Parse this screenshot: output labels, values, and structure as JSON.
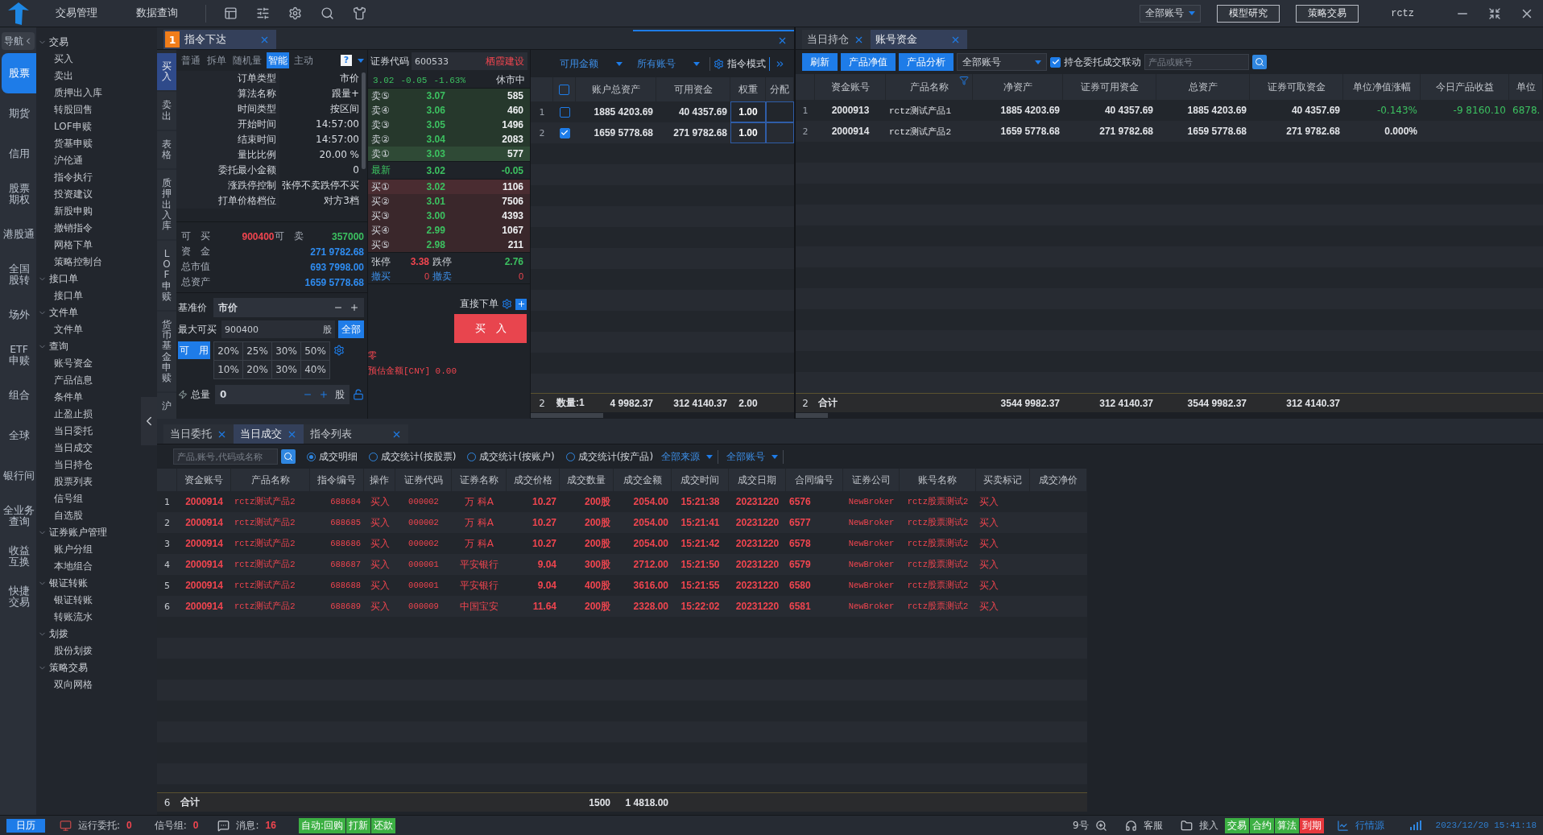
{
  "top_bar": {
    "menus": [
      "交易管理",
      "数据查询"
    ],
    "account_select": "全部账号",
    "buttons": [
      "模型研究",
      "策略交易"
    ],
    "user": "rctz"
  },
  "rail": {
    "toggle": "导航",
    "items": [
      {
        "lines": [
          "股票"
        ],
        "selected": true
      },
      {
        "lines": [
          "期货"
        ],
        "selected": false
      },
      {
        "lines": [
          "信用"
        ],
        "selected": false
      },
      {
        "lines": [
          "股票",
          "期权"
        ],
        "selected": false
      },
      {
        "lines": [
          "港股通"
        ],
        "selected": false
      },
      {
        "lines": [
          "全国",
          "股转"
        ],
        "selected": false
      },
      {
        "lines": [
          "场外"
        ],
        "selected": false
      },
      {
        "lines": [
          "ETF",
          "申赎"
        ],
        "selected": false
      },
      {
        "lines": [
          "组合"
        ],
        "selected": false
      },
      {
        "lines": [
          "全球"
        ],
        "selected": false
      },
      {
        "lines": [
          "银行间"
        ],
        "selected": false
      },
      {
        "lines": [
          "全业务",
          "查询"
        ],
        "selected": false
      },
      {
        "lines": [
          "收益",
          "互换"
        ],
        "selected": false
      },
      {
        "lines": [
          "快捷",
          "交易"
        ],
        "selected": false
      }
    ]
  },
  "nav_tree": [
    {
      "label": "交易",
      "expanded": true,
      "children": [
        {
          "label": "买入"
        },
        {
          "label": "卖出"
        },
        {
          "label": "质押出入库"
        },
        {
          "label": "转股回售"
        },
        {
          "label": "LOF申赎"
        },
        {
          "label": "货基申赎"
        },
        {
          "label": "沪伦通"
        },
        {
          "label": "指令执行"
        },
        {
          "label": "投资建议"
        },
        {
          "label": "新股申购"
        },
        {
          "label": "撤销指令"
        },
        {
          "label": "网格下单"
        },
        {
          "label": "策略控制台"
        }
      ]
    },
    {
      "label": "接口单",
      "expanded": true,
      "children": [
        {
          "label": "接口单"
        }
      ]
    },
    {
      "label": "文件单",
      "expanded": true,
      "children": [
        {
          "label": "文件单"
        }
      ]
    },
    {
      "label": "查询",
      "expanded": true,
      "children": [
        {
          "label": "账号资金"
        },
        {
          "label": "产品信息"
        },
        {
          "label": "条件单"
        },
        {
          "label": "止盈止损"
        },
        {
          "label": "当日委托"
        },
        {
          "label": "当日成交"
        },
        {
          "label": "当日持仓"
        },
        {
          "label": "股票列表"
        },
        {
          "label": "信号组"
        },
        {
          "label": "自选股"
        }
      ]
    },
    {
      "label": "证券账户管理",
      "expanded": true,
      "children": [
        {
          "label": "账户分组"
        },
        {
          "label": "本地组合"
        }
      ]
    },
    {
      "label": "银证转账",
      "expanded": true,
      "children": [
        {
          "label": "银证转账"
        },
        {
          "label": "转账流水"
        }
      ]
    },
    {
      "label": "划拨",
      "expanded": true,
      "children": [
        {
          "label": "股份划拨"
        }
      ]
    },
    {
      "label": "策略交易",
      "expanded": true,
      "children": [
        {
          "label": "双向网格"
        }
      ]
    }
  ],
  "order_panel": {
    "tab": {
      "number": "1",
      "label": "指令下达",
      "selected": true
    },
    "side_tabs": [
      {
        "label": "买入",
        "selected": true
      },
      {
        "label": "卖出",
        "selected": false
      },
      {
        "label": "表格",
        "selected": false
      },
      {
        "label": "质押出入库",
        "selected": false
      },
      {
        "label": "LOF申赎",
        "selected": false
      },
      {
        "label": "货币基金申赎",
        "selected": false
      },
      {
        "label": "沪",
        "selected": false
      }
    ],
    "mode_tabs": [
      {
        "label": "普通",
        "selected": false
      },
      {
        "label": "拆单",
        "selected": false
      },
      {
        "label": "随机量",
        "selected": false
      },
      {
        "label": "智能",
        "selected": true
      },
      {
        "label": "主动",
        "selected": false
      }
    ],
    "help": "?",
    "params": [
      {
        "label": "订单类型",
        "value": "市价"
      },
      {
        "label": "算法名称",
        "value": "跟量+"
      },
      {
        "label": "时间类型",
        "value": "按区间"
      },
      {
        "label": "开始时间",
        "value": "14:57:00"
      },
      {
        "label": "结束时间",
        "value": "14:57:00"
      },
      {
        "label": "量比比例",
        "value": "20.00 %"
      },
      {
        "label": "委托最小金额",
        "value": "0"
      },
      {
        "label": "涨跌停控制",
        "value": "张停不卖跌停不买"
      },
      {
        "label": "打单价格档位",
        "value": "对方3档"
      }
    ],
    "summary": {
      "can_buy": {
        "label": "可　买",
        "value": "900400"
      },
      "can_sell": {
        "label": "可　卖",
        "value": "357000"
      },
      "rows": [
        {
          "label": "资　金",
          "value": "271 9782.68"
        },
        {
          "label": "总市值",
          "value": "693 7998.00"
        },
        {
          "label": "总资产",
          "value": "1659 5778.68"
        }
      ]
    },
    "base_price": {
      "label": "基准价",
      "value": "市价"
    },
    "max_buy": {
      "label": "最大可买",
      "value": "900400",
      "unit": "股",
      "button": "全部"
    },
    "available": "可　用",
    "percents": [
      "20%",
      "25%",
      "30%",
      "50%",
      "10%",
      "20%",
      "30%",
      "40%"
    ],
    "total": {
      "label": "总量",
      "value": "0",
      "unit": "股"
    },
    "direct_order": "直接下单",
    "buy_button": "买　入",
    "odd_lot": "零",
    "estimate": "预估金额[CNY] 0.00",
    "quote": {
      "code_label": "证券代码",
      "code": "600533",
      "name": "栖霞建设",
      "price": "3.02",
      "change": "-0.05",
      "change_pct": "-1.63%",
      "status": "休市中",
      "asks": [
        {
          "label": "卖⑤",
          "price": "3.07",
          "volume": "585"
        },
        {
          "label": "卖④",
          "price": "3.06",
          "volume": "460"
        },
        {
          "label": "卖③",
          "price": "3.05",
          "volume": "1496"
        },
        {
          "label": "卖②",
          "price": "3.04",
          "volume": "2083"
        },
        {
          "label": "卖①",
          "price": "3.03",
          "volume": "577"
        }
      ],
      "last": {
        "label": "最新",
        "price": "3.02",
        "change": "-0.05"
      },
      "bids": [
        {
          "label": "买①",
          "price": "3.02",
          "volume": "1106"
        },
        {
          "label": "买②",
          "price": "3.01",
          "volume": "7506"
        },
        {
          "label": "买③",
          "price": "3.00",
          "volume": "4393"
        },
        {
          "label": "买④",
          "price": "2.99",
          "volume": "1067"
        },
        {
          "label": "买⑤",
          "price": "2.98",
          "volume": "211"
        }
      ],
      "limit_up": {
        "label": "张停",
        "value": "3.38"
      },
      "limit_down": {
        "label": "跌停",
        "value": "2.76"
      },
      "cancel_buy": {
        "label": "撤买",
        "value": "0"
      },
      "cancel_sell": {
        "label": "撤卖",
        "value": "0"
      }
    },
    "accounts": {
      "filters": [
        "可用金额",
        "所有账号"
      ],
      "mode": "指令模式",
      "select_all_checked": false,
      "columns": [
        "账户总资产",
        "可用资金",
        "权重",
        "分配"
      ],
      "rows": [
        {
          "index": "1",
          "checked": false,
          "total": "1885 4203.69",
          "available": "40 4357.69",
          "weight": "1.00"
        },
        {
          "index": "2",
          "checked": true,
          "total": "1659 5778.68",
          "available": "271 9782.68",
          "weight": "1.00"
        }
      ],
      "footer": {
        "index": "2",
        "count": "数量:1",
        "total": "4 9982.37",
        "available": "312 4140.37",
        "weight": "2.00"
      }
    }
  },
  "account_panel": {
    "tabs": [
      {
        "label": "当日持仓",
        "selected": false
      },
      {
        "label": "账号资金",
        "selected": true
      }
    ],
    "buttons": [
      "刷新",
      "产品净值",
      "产品分析"
    ],
    "account_select": "全部账号",
    "link": {
      "label": "持仓委托成交联动",
      "checked": true
    },
    "search_placeholder": "产品或账号",
    "columns": [
      "资金账号",
      "产品名称",
      "净资产",
      "证券可用资金",
      "总资产",
      "证券可取资金",
      "单位净值涨幅",
      "今日产品收益",
      "单位"
    ],
    "rows": [
      {
        "index": "1",
        "cells": [
          "2000913",
          "rctz测试产品1",
          "1885 4203.69",
          "40 4357.69",
          "1885 4203.69",
          "40 4357.69",
          {
            "text": "-0.143%",
            "color": "#3cc060"
          },
          {
            "text": "-9 8160.10",
            "color": "#3cc060"
          },
          {
            "text": "6878.",
            "color": "#3cc060"
          }
        ]
      },
      {
        "index": "2",
        "cells": [
          "2000914",
          "rctz测试产品2",
          "1659 5778.68",
          "271 9782.68",
          "1659 5778.68",
          "271 9782.68",
          "0.000%"
        ]
      }
    ],
    "footer": {
      "index": "2",
      "label": "合计",
      "cells": [
        "3544 9982.37",
        "312 4140.37",
        "3544 9982.37",
        "312 4140.37"
      ]
    }
  },
  "trades_panel": {
    "tabs": [
      {
        "label": "当日委托",
        "selected": false
      },
      {
        "label": "当日成交",
        "selected": true
      },
      {
        "label": "指令列表",
        "selected": false
      }
    ],
    "search_placeholder": "产品,账号,代码或名称",
    "views": [
      {
        "label": "成交明细",
        "selected": true
      },
      {
        "label": "成交统计(按股票)",
        "selected": false
      },
      {
        "label": "成交统计(按账户)",
        "selected": false
      },
      {
        "label": "成交统计(按产品)",
        "selected": false
      }
    ],
    "filters": [
      "全部来源",
      "全部账号"
    ],
    "columns": [
      "资金账号",
      "产品名称",
      "指令编号",
      "操作",
      "证券代码",
      "证券名称",
      "成交价格",
      "成交数量",
      "成交金额",
      "成交时间",
      "成交日期",
      "合同编号",
      "证券公司",
      "账号名称",
      "买卖标记",
      "成交净价"
    ],
    "rows": [
      {
        "index": "1",
        "cells": [
          "2000914",
          "rctz测试产品2",
          "688684",
          "买入",
          "000002",
          "万 科A",
          "10.27",
          "200股",
          "2054.00",
          "15:21:38",
          "20231220",
          "6576",
          "NewBroker",
          "rctz股票测试2",
          "买入"
        ]
      },
      {
        "index": "2",
        "cells": [
          "2000914",
          "rctz测试产品2",
          "688685",
          "买入",
          "000002",
          "万 科A",
          "10.27",
          "200股",
          "2054.00",
          "15:21:41",
          "20231220",
          "6577",
          "NewBroker",
          "rctz股票测试2",
          "买入"
        ]
      },
      {
        "index": "3",
        "cells": [
          "2000914",
          "rctz测试产品2",
          "688686",
          "买入",
          "000002",
          "万 科A",
          "10.27",
          "200股",
          "2054.00",
          "15:21:42",
          "20231220",
          "6578",
          "NewBroker",
          "rctz股票测试2",
          "买入"
        ]
      },
      {
        "index": "4",
        "cells": [
          "2000914",
          "rctz测试产品2",
          "688687",
          "买入",
          "000001",
          "平安银行",
          "9.04",
          "300股",
          "2712.00",
          "15:21:50",
          "20231220",
          "6579",
          "NewBroker",
          "rctz股票测试2",
          "买入"
        ]
      },
      {
        "index": "5",
        "cells": [
          "2000914",
          "rctz测试产品2",
          "688688",
          "买入",
          "000001",
          "平安银行",
          "9.04",
          "400股",
          "3616.00",
          "15:21:55",
          "20231220",
          "6580",
          "NewBroker",
          "rctz股票测试2",
          "买入"
        ]
      },
      {
        "index": "6",
        "cells": [
          "2000914",
          "rctz测试产品2",
          "688689",
          "买入",
          "000009",
          "中国宝安",
          "11.64",
          "200股",
          "2328.00",
          "15:22:02",
          "20231220",
          "6581",
          "NewBroker",
          "rctz股票测试2",
          "买入"
        ]
      }
    ],
    "footer": {
      "index": "6",
      "label": "合计",
      "volume": "1500",
      "amount": "1 4818.00"
    }
  },
  "status_bar": {
    "calendar": "日历",
    "running": {
      "label": "运行委托:",
      "value": "0"
    },
    "signal": {
      "label": "信号组:",
      "value": "0"
    },
    "messages": {
      "label": "消息:",
      "value": "16"
    },
    "auto_tags": [
      "自动:回购",
      "打新",
      "还款"
    ],
    "zoom": "9号",
    "support": "客服",
    "access": "接入",
    "channels": [
      {
        "label": "交易",
        "color": "#3cb043"
      },
      {
        "label": "合约",
        "color": "#3cb043"
      },
      {
        "label": "算法",
        "color": "#3cb043"
      },
      {
        "label": "到期",
        "color": "#e8383d"
      }
    ],
    "quote_source": "行情源",
    "datetime": "2023/12/20 15:41:18"
  }
}
